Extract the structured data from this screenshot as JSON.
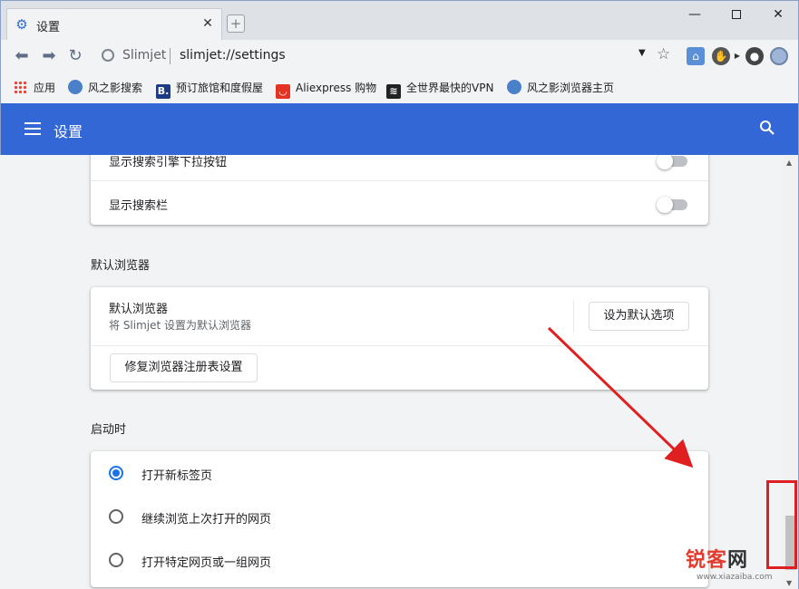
{
  "window": {
    "tab_title": "设置",
    "tab_close": "✕",
    "new_tab": "+",
    "minimize": "—",
    "close": "✕"
  },
  "toolbar": {
    "back": "⬅",
    "forward": "➡",
    "reload": "↻",
    "site_name": "Slimjet",
    "url": "slimjet://settings",
    "dropdown": "▼",
    "star": "☆"
  },
  "bookmarks": [
    {
      "label": "应用",
      "icon": "apps-grid-icon"
    },
    {
      "label": "风之影搜索",
      "icon": "globe-icon"
    },
    {
      "label": "预订旅馆和度假屋",
      "icon": "booking-icon",
      "glyph": "B."
    },
    {
      "label": "Aliexpress 购物",
      "icon": "aliexpress-icon",
      "glyph": "◡"
    },
    {
      "label": "全世界最快的VPN",
      "icon": "vpn-icon",
      "glyph": "≋"
    },
    {
      "label": "风之影浏览器主页",
      "icon": "globe-icon"
    }
  ],
  "header": {
    "title": "设置"
  },
  "search_section": {
    "rows": [
      {
        "label": "显示搜索引擎下拉按钮",
        "enabled": false
      },
      {
        "label": "显示搜索栏",
        "enabled": false
      }
    ]
  },
  "default_browser": {
    "section_title": "默认浏览器",
    "row_title": "默认浏览器",
    "row_subtitle": "将 Slimjet 设置为默认浏览器",
    "set_default_button": "设为默认选项",
    "repair_button": "修复浏览器注册表设置"
  },
  "startup": {
    "section_title": "启动时",
    "options": [
      {
        "label": "打开新标签页",
        "selected": true
      },
      {
        "label": "继续浏览上次打开的网页",
        "selected": false
      },
      {
        "label": "打开特定网页或一组网页",
        "selected": false
      }
    ]
  },
  "scrollbar": {
    "up": "▲",
    "down": "▼"
  },
  "watermark": {
    "main_red": "锐客",
    "main_dark": "网",
    "sub": "www.xiazaiba.com"
  },
  "colors": {
    "header_bg": "#3367d6",
    "accent": "#1a73e8",
    "annotation": "#e02020"
  }
}
